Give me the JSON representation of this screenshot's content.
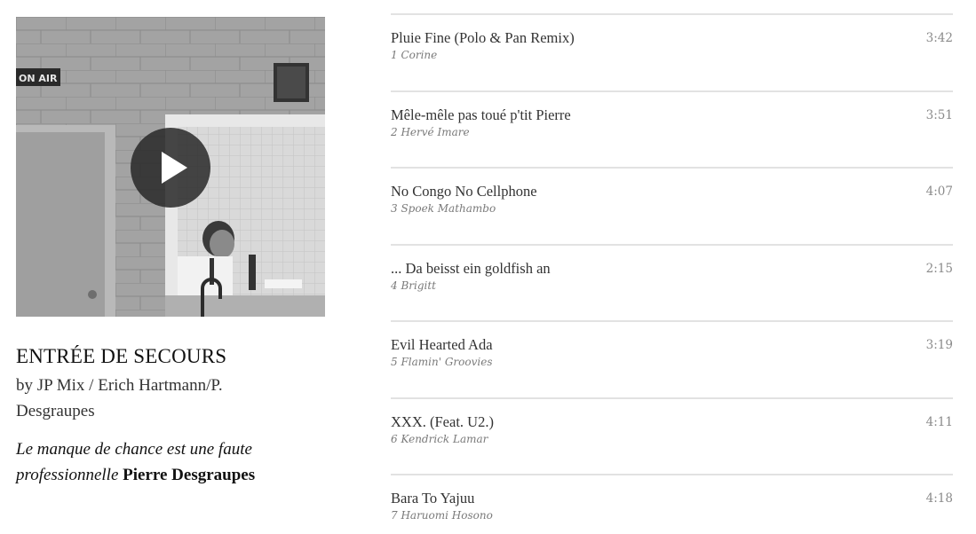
{
  "mix": {
    "title": "ENTRÉE DE SECOURS",
    "by": "by JP Mix / Erich Hartmann/P. Desgraupes",
    "quote_text": "Le manque de chance est une faute professionnelle",
    "quote_author": "Pierre Desgraupes",
    "cover_sign_text": "ON AIR"
  },
  "tracks": [
    {
      "title": "Pluie Fine (Polo & Pan Remix)",
      "artist": "1 Corine",
      "duration": "3:42"
    },
    {
      "title": "Mêle-mêle pas toué p'tit Pierre",
      "artist": "2 Hervé Imare",
      "duration": "3:51"
    },
    {
      "title": "No Congo No Cellphone",
      "artist": "3 Spoek Mathambo",
      "duration": "4:07"
    },
    {
      "title": "... Da beisst ein goldfish an",
      "artist": "4 Brigitt",
      "duration": "2:15"
    },
    {
      "title": "Evil Hearted Ada",
      "artist": "5 Flamin' Groovies",
      "duration": "3:19"
    },
    {
      "title": "XXX. (Feat. U2.)",
      "artist": "6 Kendrick Lamar",
      "duration": "4:11"
    },
    {
      "title": "Bara To Yajuu",
      "artist": "7 Haruomi Hosono",
      "duration": "4:18"
    }
  ]
}
